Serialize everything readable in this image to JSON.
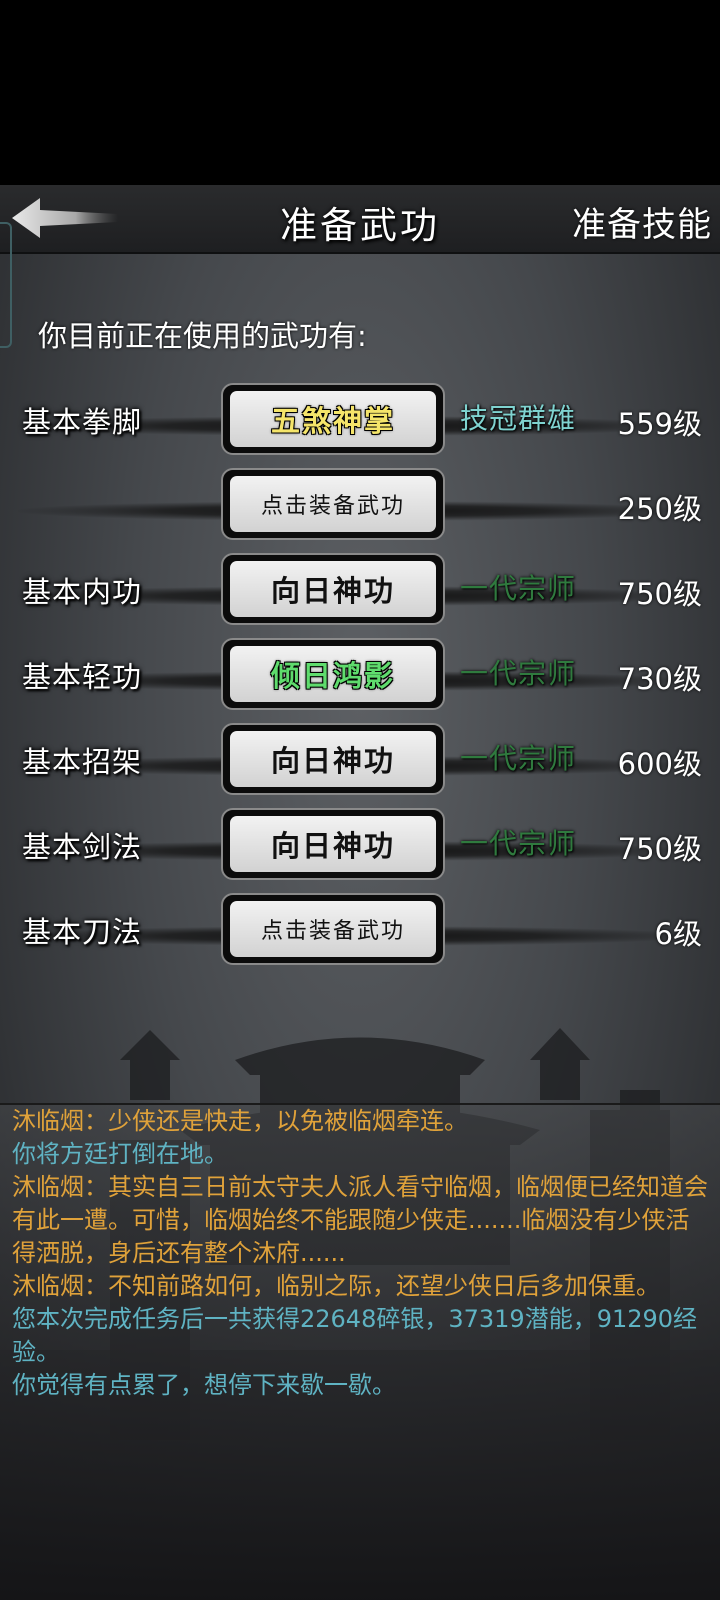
{
  "header": {
    "title": "准备武功",
    "right_action": "准备技能",
    "back_icon": "back-arrow-icon"
  },
  "subtitle": "你目前正在使用的武功有:",
  "skills": [
    {
      "name": "基本拳脚",
      "equipped": "五煞神掌",
      "equipped_color": "#f5e56a",
      "rank": "技冠群雄",
      "rank_color": "#7fd3d0",
      "level": "559级"
    },
    {
      "name": "",
      "equipped": "点击装备武功",
      "equipped_color": "#111111",
      "rank": "",
      "rank_color": "",
      "level": "250级"
    },
    {
      "name": "基本内功",
      "equipped": "向日神功",
      "equipped_color": "#111111",
      "rank": "一代宗师",
      "rank_color": "#2f7a3e",
      "level": "750级"
    },
    {
      "name": "基本轻功",
      "equipped": "倾日鸿影",
      "equipped_color": "#5fdc6d",
      "rank": "一代宗师",
      "rank_color": "#2f7a3e",
      "level": "730级"
    },
    {
      "name": "基本招架",
      "equipped": "向日神功",
      "equipped_color": "#111111",
      "rank": "一代宗师",
      "rank_color": "#2f7a3e",
      "level": "600级"
    },
    {
      "name": "基本剑法",
      "equipped": "向日神功",
      "equipped_color": "#111111",
      "rank": "一代宗师",
      "rank_color": "#2f7a3e",
      "level": "750级"
    },
    {
      "name": "基本刀法",
      "equipped": "点击装备武功",
      "equipped_color": "#111111",
      "rank": "",
      "rank_color": "",
      "level": "6级"
    }
  ],
  "log": [
    {
      "text": "沐临烟：少侠还是快走，以免被临烟牵连。",
      "color": "#e0a23a"
    },
    {
      "text": "你将方廷打倒在地。",
      "color": "#5fb3c3"
    },
    {
      "text": "沐临烟：其实自三日前太守夫人派人看守临烟，临烟便已经知道会有此一遭。可惜，临烟始终不能跟随少侠走.......临烟没有少侠活得洒脱，身后还有整个沐府......",
      "color": "#e0a23a"
    },
    {
      "text": "沐临烟：不知前路如何，临别之际，还望少侠日后多加保重。",
      "color": "#e0a23a"
    },
    {
      "text": "您本次完成任务后一共获得22648碎银，37319潜能，91290经验。",
      "color": "#5fb3c3"
    },
    {
      "text": "你觉得有点累了，想停下来歇一歇。",
      "color": "#5fb3c3"
    }
  ]
}
